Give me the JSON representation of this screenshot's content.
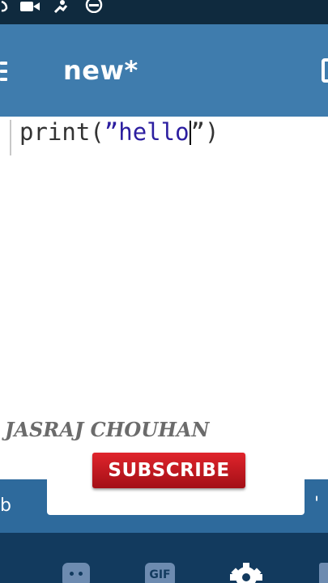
{
  "status_bar": {
    "icons": [
      "signal-icon",
      "video-camera-icon",
      "run-icon",
      "do-not-disturb-icon"
    ]
  },
  "app_bar": {
    "title": "new*",
    "icons": [
      "menu-icon",
      "document-icon"
    ]
  },
  "editor": {
    "code": {
      "func": "print(",
      "quote_open": "”",
      "string": "hello",
      "quote_close": "”)"
    }
  },
  "overlay": {
    "watermark": "JASRAJ CHOUHAN",
    "subscribe_label": "SUBSCRIBE"
  },
  "keyboard": {
    "suggestion_left": "b",
    "suggestion_right": "'",
    "toolbar_icons": [
      "sticker-icon",
      "gif-icon",
      "gear-icon"
    ],
    "gif_label": "GIF"
  },
  "colors": {
    "app_bar": "#3f7cad",
    "status_bar": "#0f2a3e",
    "keyboard_toolbar": "#123a5e",
    "subscribe": "#d01c24",
    "string": "#2c1ea0"
  }
}
